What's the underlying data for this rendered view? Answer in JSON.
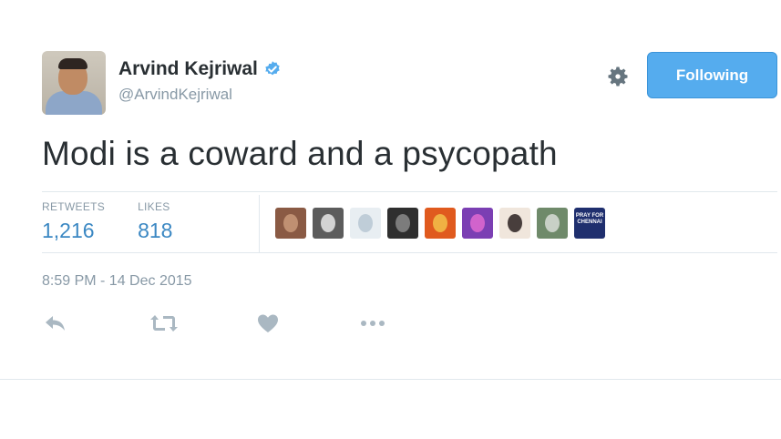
{
  "user": {
    "name": "Arvind Kejriwal",
    "handle": "@ArvindKejriwal",
    "verified": true,
    "verified_icon": "verified-badge-icon"
  },
  "header": {
    "settings_icon": "gear-icon",
    "follow_button_label": "Following"
  },
  "tweet": {
    "text": "Modi is a coward and a psycopath"
  },
  "stats": {
    "retweets_label": "RETWEETS",
    "retweets_value": "1,216",
    "likes_label": "LIKES",
    "likes_value": "818"
  },
  "likers": [
    {
      "color": "#8a5a44",
      "accent": "#c99a7a"
    },
    {
      "color": "#5c5c5c",
      "accent": "#e8e8e8"
    },
    {
      "color": "#e8eef2",
      "accent": "#b7c7d3"
    },
    {
      "color": "#2f2f2f",
      "accent": "#8a8a8a"
    },
    {
      "color": "#e05a1e",
      "accent": "#f2c14a"
    },
    {
      "color": "#7b3fb3",
      "accent": "#e06ad0"
    },
    {
      "color": "#f0e6dc",
      "accent": "#2a2020"
    },
    {
      "color": "#6f8a6a",
      "accent": "#d8dcd6"
    },
    {
      "color": "#1f2f6e",
      "accent": "#ffffff",
      "text": "PRAY FOR CHENNAI"
    }
  ],
  "timestamp": "8:59 PM - 14 Dec 2015",
  "actions": {
    "reply_icon": "reply-icon",
    "retweet_icon": "retweet-icon",
    "like_icon": "heart-icon",
    "more_icon": "more-dots-icon"
  },
  "colors": {
    "accent": "#55acee",
    "link": "#3b88c3",
    "muted": "#8899a6",
    "text": "#292f33",
    "divider": "#e1e8ed"
  }
}
